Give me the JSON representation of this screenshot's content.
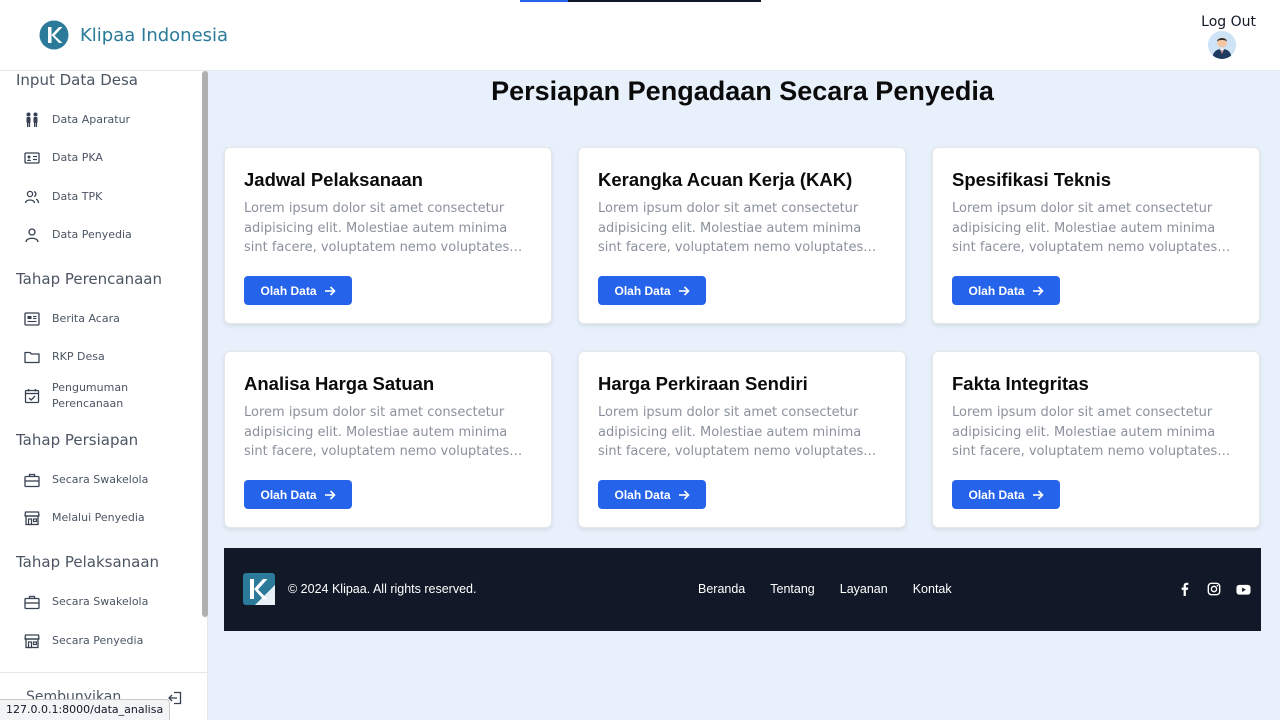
{
  "header": {
    "brand_name": "Klipaa Indonesia",
    "logout_label": "Log Out",
    "progress_fraction": 0.2
  },
  "sidebar": {
    "sections": [
      {
        "title": "Input Data Desa",
        "items": [
          {
            "label": "Data Aparatur",
            "icon": "people-icon"
          },
          {
            "label": "Data PKA",
            "icon": "id-card-icon"
          },
          {
            "label": "Data TPK",
            "icon": "users-icon"
          },
          {
            "label": "Data Penyedia",
            "icon": "user-icon"
          }
        ]
      },
      {
        "title": "Tahap Perencanaan",
        "items": [
          {
            "label": "Berita Acara",
            "icon": "news-icon"
          },
          {
            "label": "RKP Desa",
            "icon": "folder-icon"
          },
          {
            "label": "Pengumuman Perencanaan",
            "icon": "calendar-check-icon"
          }
        ]
      },
      {
        "title": "Tahap Persiapan",
        "items": [
          {
            "label": "Secara Swakelola",
            "icon": "briefcase-icon"
          },
          {
            "label": "Melalui Penyedia",
            "icon": "store-icon"
          }
        ]
      },
      {
        "title": "Tahap Pelaksanaan",
        "items": [
          {
            "label": "Secara Swakelola",
            "icon": "briefcase-icon"
          },
          {
            "label": "Secara Penyedia",
            "icon": "store-icon"
          }
        ]
      }
    ],
    "hide_label": "Sembunyikan",
    "status_url": "127.0.0.1:8000/data_analisa"
  },
  "main": {
    "title": "Persiapan Pengadaan Secara Penyedia",
    "cards": [
      {
        "title": "Jadwal Pelaksanaan",
        "description": "Lorem ipsum dolor sit amet consectetur adipisicing elit. Molestiae autem minima sint facere, voluptatem nemo voluptates sapiente…",
        "button": "Olah Data"
      },
      {
        "title": "Kerangka Acuan Kerja (KAK)",
        "description": "Lorem ipsum dolor sit amet consectetur adipisicing elit. Molestiae autem minima sint facere, voluptatem nemo voluptates sapiente…",
        "button": "Olah Data"
      },
      {
        "title": "Spesifikasi Teknis",
        "description": "Lorem ipsum dolor sit amet consectetur adipisicing elit. Molestiae autem minima sint facere, voluptatem nemo voluptates sapiente…",
        "button": "Olah Data"
      },
      {
        "title": "Analisa Harga Satuan",
        "description": "Lorem ipsum dolor sit amet consectetur adipisicing elit. Molestiae autem minima sint facere, voluptatem nemo voluptates sapiente…",
        "button": "Olah Data"
      },
      {
        "title": "Harga Perkiraan Sendiri",
        "description": "Lorem ipsum dolor sit amet consectetur adipisicing elit. Molestiae autem minima sint facere, voluptatem nemo voluptates sapiente…",
        "button": "Olah Data"
      },
      {
        "title": "Fakta Integritas",
        "description": "Lorem ipsum dolor sit amet consectetur adipisicing elit. Molestiae autem minima sint facere, voluptatem nemo voluptates sapiente…",
        "button": "Olah Data"
      }
    ]
  },
  "footer": {
    "copyright": "© 2024 Klipaa. All rights reserved.",
    "links": [
      "Beranda",
      "Tentang",
      "Layanan",
      "Kontak"
    ],
    "social": [
      "facebook-icon",
      "instagram-icon",
      "youtube-icon"
    ]
  },
  "colors": {
    "accent": "#2563eb",
    "brand": "#2b7a9a",
    "footer_bg": "#111827",
    "page_bg": "#e8f1fb"
  }
}
